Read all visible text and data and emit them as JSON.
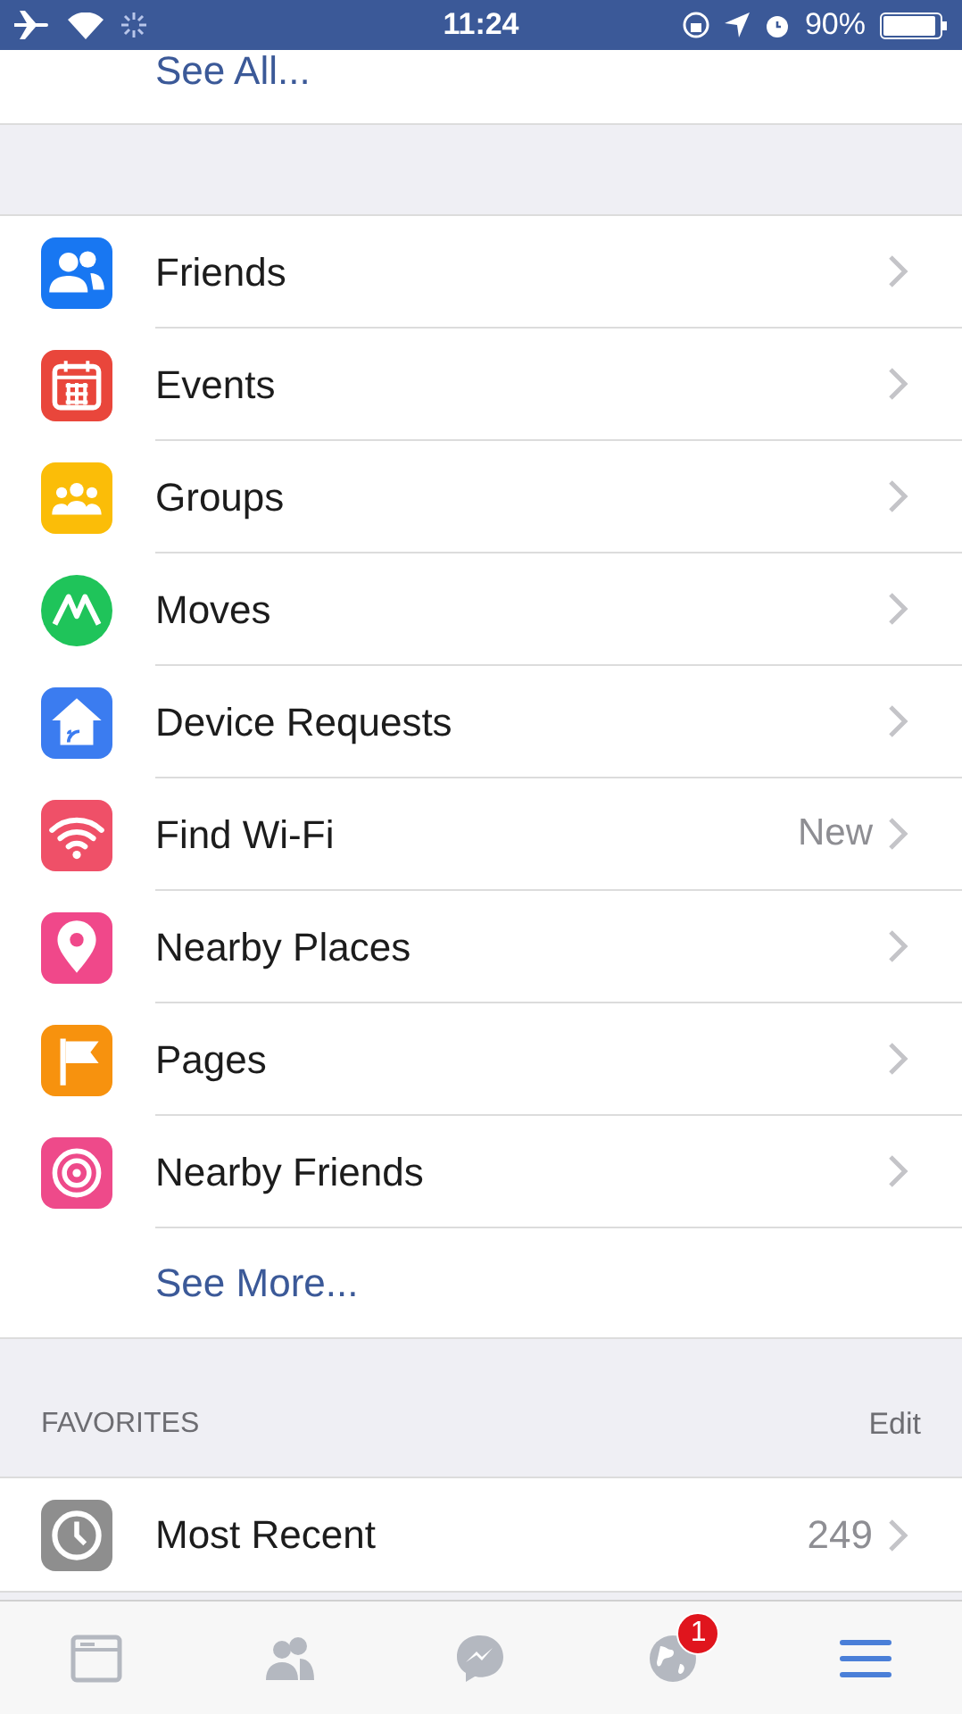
{
  "status_bar": {
    "time": "11:24",
    "battery": "90%"
  },
  "see_all": "See All...",
  "menu_items": [
    {
      "kind": "friends",
      "label": "Friends",
      "color": "#1877f2"
    },
    {
      "kind": "events",
      "label": "Events",
      "color": "#e9463b"
    },
    {
      "kind": "groups",
      "label": "Groups",
      "color": "#fbbd08"
    },
    {
      "kind": "moves",
      "label": "Moves",
      "color": "#1fc45a"
    },
    {
      "kind": "devices",
      "label": "Device Requests",
      "color": "#3b7cf0"
    },
    {
      "kind": "wifi",
      "label": "Find Wi-Fi",
      "color": "#ef5068",
      "badge": "New"
    },
    {
      "kind": "places",
      "label": "Nearby Places",
      "color": "#f0488a"
    },
    {
      "kind": "pages",
      "label": "Pages",
      "color": "#f7920e"
    },
    {
      "kind": "nearby",
      "label": "Nearby Friends",
      "color": "#ee4a8a"
    }
  ],
  "see_more": "See More...",
  "favorites": {
    "title": "FAVORITES",
    "action": "Edit",
    "items": [
      {
        "kind": "recent",
        "label": "Most Recent",
        "color": "#8e8e8e",
        "count": "249"
      }
    ]
  },
  "tab_bar": [
    {
      "kind": "feed",
      "selected": false
    },
    {
      "kind": "friends",
      "selected": false
    },
    {
      "kind": "messenger",
      "selected": false
    },
    {
      "kind": "notifications",
      "selected": false,
      "badge": "1"
    },
    {
      "kind": "menu",
      "selected": true
    }
  ]
}
